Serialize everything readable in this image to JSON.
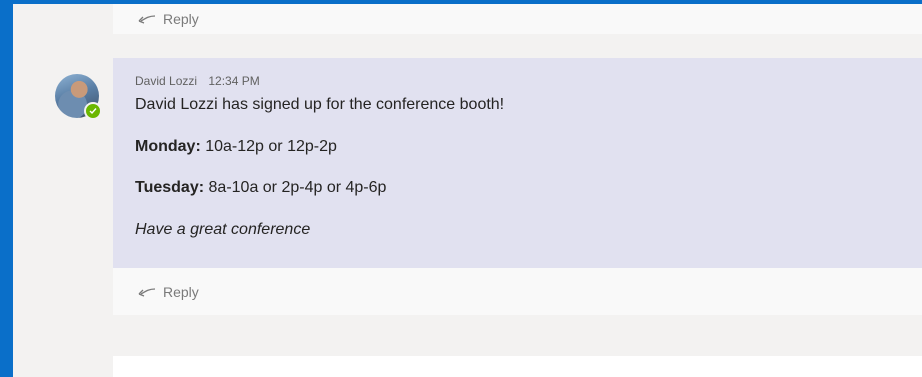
{
  "reply_label": "Reply",
  "message": {
    "author": "David Lozzi",
    "time": "12:34 PM",
    "line1": "David Lozzi has signed up for the conference booth!",
    "monday_label": "Monday:",
    "monday_value": "10a-12p or 12p-2p",
    "tuesday_label": "Tuesday:",
    "tuesday_value": "8a-10a or 2p-4p or 4p-6p",
    "closing": "Have a great conference"
  },
  "colors": {
    "frame": "#0a6fc9",
    "card": "#e1e1f0",
    "presence": "#6bb700"
  },
  "icons": {
    "reply": "reply-arrow-icon",
    "presence": "available-check-icon"
  }
}
